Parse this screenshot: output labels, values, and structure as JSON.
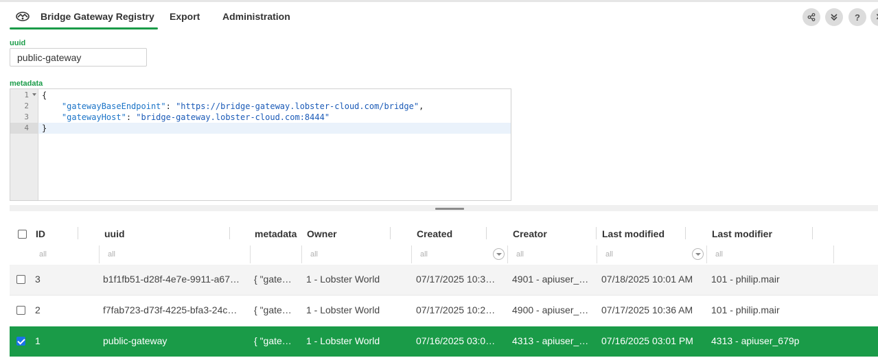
{
  "header": {
    "tabs": [
      {
        "label": "Bridge Gateway Registry",
        "active": true
      },
      {
        "label": "Export",
        "active": false
      },
      {
        "label": "Administration",
        "active": false
      }
    ],
    "actions": [
      {
        "icon": "share-icon",
        "glyph": "⋲"
      },
      {
        "icon": "chevrons-down-icon",
        "glyph": "︾"
      },
      {
        "icon": "help-icon",
        "glyph": "?"
      },
      {
        "icon": "close-icon",
        "glyph": "✕"
      }
    ]
  },
  "form": {
    "uuid_label": "uuid",
    "uuid_value": "public-gateway",
    "metadata_label": "metadata"
  },
  "editor": {
    "line_numbers": [
      "1",
      "2",
      "3",
      "4"
    ],
    "lines": [
      {
        "open": "{"
      },
      {
        "key": "\"gatewayBaseEndpoint\"",
        "colon": ": ",
        "value": "\"https://bridge-gateway.lobster-cloud.com/bridge\"",
        "tail": ","
      },
      {
        "key": "\"gatewayHost\"",
        "colon": ": ",
        "value": "\"bridge-gateway.lobster-cloud.com:8444\"",
        "tail": ""
      },
      {
        "open": "}"
      }
    ]
  },
  "grid": {
    "columns": [
      {
        "title": "ID",
        "filter": "all"
      },
      {
        "title": "uuid",
        "filter": "all"
      },
      {
        "title": "metadata",
        "filter": ""
      },
      {
        "title": "Owner",
        "filter": "all"
      },
      {
        "title": "Created",
        "filter": "all"
      },
      {
        "title": "Creator",
        "filter": "all"
      },
      {
        "title": "Last modified",
        "filter": "all"
      },
      {
        "title": "Last modifier",
        "filter": "all"
      }
    ],
    "rows": [
      {
        "id": "3",
        "uuid": "b1f1fb51-d28f-4e7e-9911-a67…",
        "metadata": "{ \"gate…",
        "owner": "1 - Lobster World",
        "created": "07/17/2025 10:3…",
        "creator": "4901 - apiuser_…",
        "last_modified": "07/18/2025 10:01 AM",
        "last_modifier": "101 - philip.mair",
        "selected": false
      },
      {
        "id": "2",
        "uuid": "f7fab723-d73f-4225-bfa3-24c…",
        "metadata": "{ \"gate…",
        "owner": "1 - Lobster World",
        "created": "07/17/2025 10:2…",
        "creator": "4900 - apiuser_…",
        "last_modified": "07/17/2025 10:36 AM",
        "last_modifier": "101 - philip.mair",
        "selected": false
      },
      {
        "id": "1",
        "uuid": "public-gateway",
        "metadata": "{ \"gate…",
        "owner": "1 - Lobster World",
        "created": "07/16/2025 03:0…",
        "creator": "4313 - apiuser_…",
        "last_modified": "07/16/2025 03:01 PM",
        "last_modifier": "4313 - apiuser_679p",
        "selected": true
      }
    ]
  },
  "colors": {
    "accent": "#1a9b48",
    "selected_row": "#1a9b48"
  }
}
